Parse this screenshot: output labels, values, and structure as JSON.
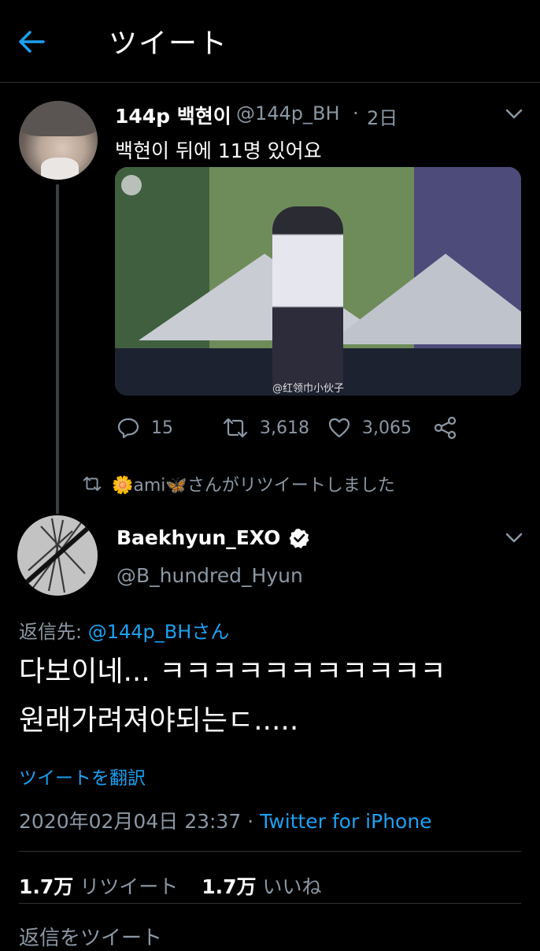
{
  "colors": {
    "background": "#000000",
    "text": "#ffffff",
    "muted": "#8b98a5",
    "accent": "#1da1f2",
    "divider": "#2f3336"
  },
  "header": {
    "title": "ツイート",
    "back_icon": "back-arrow-icon"
  },
  "parent_tweet": {
    "name": "144p 백현이",
    "handle": "@144p_BH",
    "separator": "·",
    "time": "2日",
    "text": "백현이 뒤에 11명 있어요",
    "media_watermark": "@红领巾小伙子",
    "actions": {
      "replies": "15",
      "retweets": "3,618",
      "likes": "3,065"
    }
  },
  "retweet_banner": {
    "text": "🌼ami🦋さんがリツイートしました",
    "icon": "retweet-icon"
  },
  "main_tweet": {
    "name": "Baekhyun_EXO",
    "verified_icon": "verified-badge-icon",
    "handle": "@B_hundred_Hyun",
    "reply_prefix": "返信先:",
    "reply_target": "@144p_BHさん",
    "text_line1": "다보이네... ㅋㅋㅋㅋㅋㅋㅋㅋㅋㅋㅋ",
    "text_line2": "원래가려져야되는ㄷ.....",
    "translate_label": "ツイートを翻訳",
    "timestamp": "2020年02月04日 23:37",
    "meta_separator": "·",
    "source": "Twitter for iPhone",
    "retweet_count": "1.7万",
    "retweet_label": "リツイート",
    "like_count": "1.7万",
    "like_label": "いいね"
  },
  "reply_box": {
    "placeholder": "返信をツイート"
  }
}
